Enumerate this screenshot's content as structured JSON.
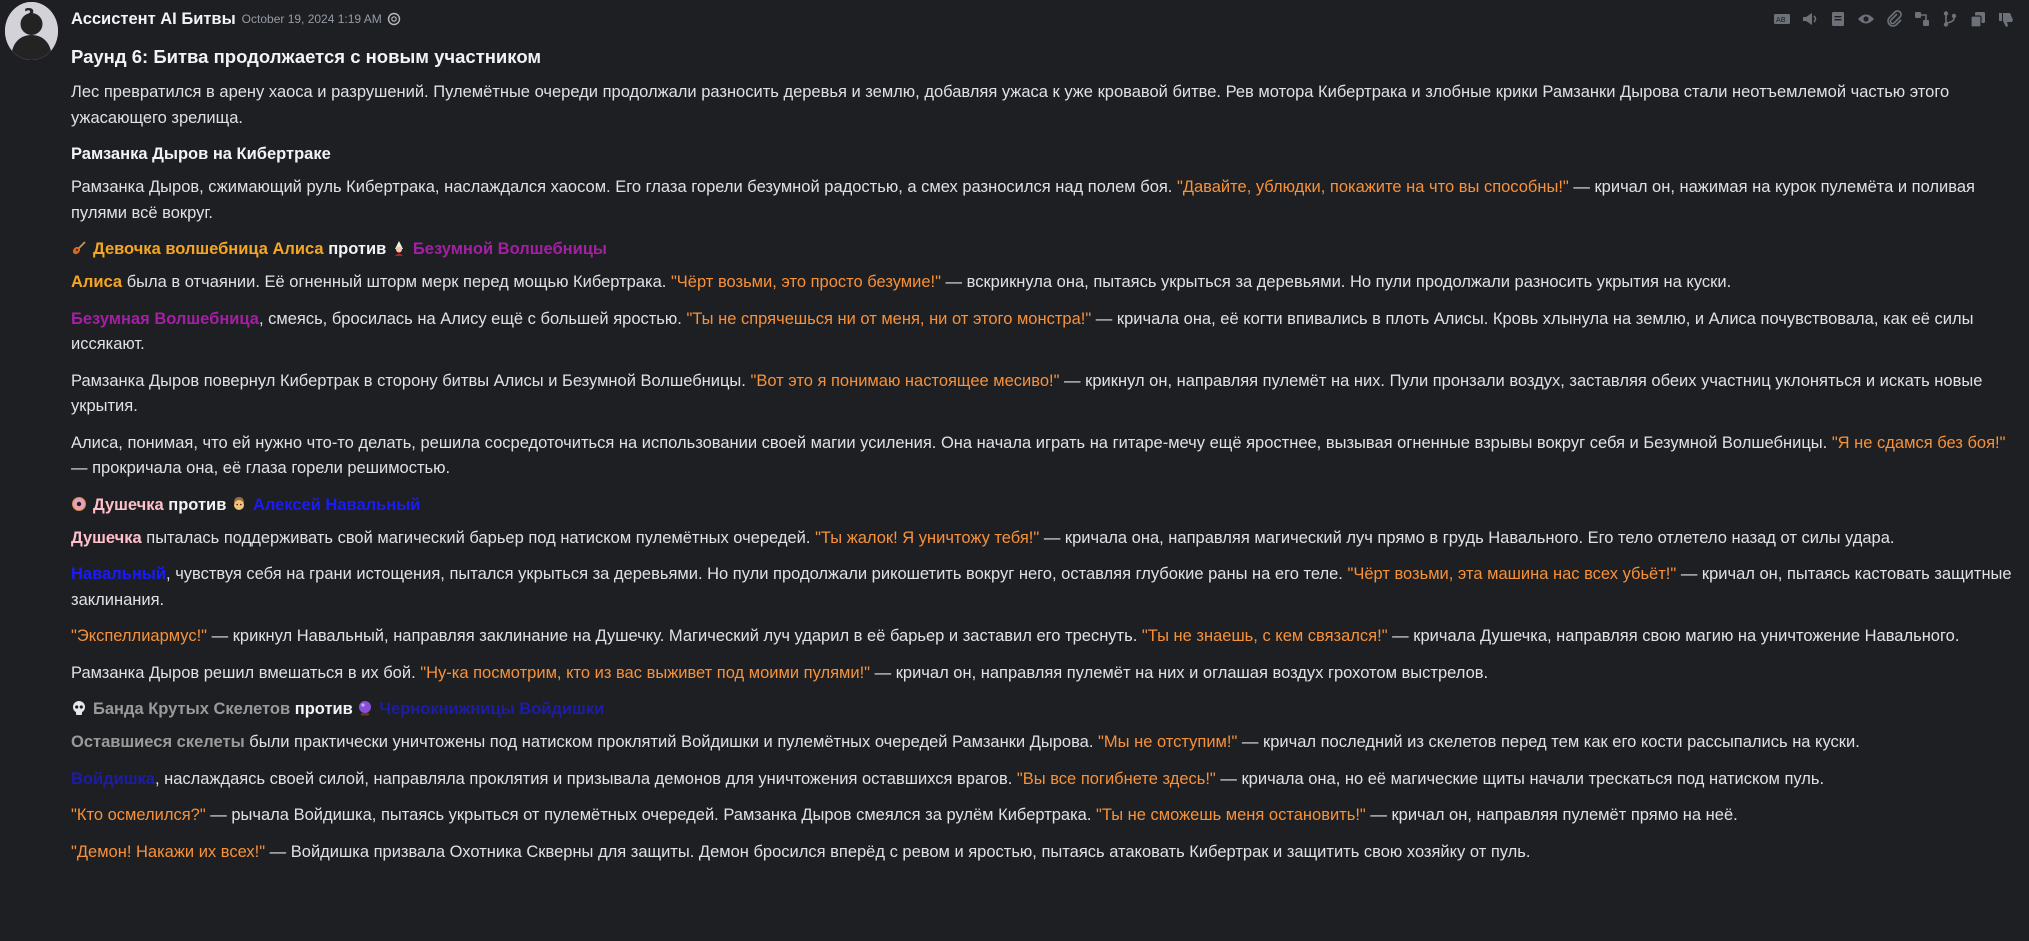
{
  "message": {
    "author": "Ассистент AI Битвы",
    "timestamp": "October 19, 2024 1:19 AM",
    "toolbar_icons": [
      "translate-icon",
      "speaker-icon",
      "document-icon",
      "eye-icon",
      "attachment-icon",
      "fork-icon",
      "branch-icon",
      "copy-icon",
      "thumbs-down-icon"
    ],
    "round_title": "Раунд 6: Битва продолжается с новым участником",
    "intro": "Лес превратился в арену хаоса и разрушений. Пулемётные очереди продолжали разносить деревья и землю, добавляя ужаса к уже кровавой битве. Рев мотора Кибертрака и злобные крики Рамзанки Дырова стали неотъемлемой частью этого ужасающего зрелища.",
    "s1": {
      "heading": "Рамзанка Дыров на Кибертраке",
      "p1": {
        "a": "Рамзанка Дыров, сжимающий руль Кибертрака, наслаждался хаосом. Его глаза горели безумной радостью, а смех разносился над полем боя. ",
        "q": "\"Давайте, ублюдки, покажите на что вы способны!\"",
        "b": " — кричал он, нажимая на курок пулемёта и поливая пулями всё вокруг."
      }
    },
    "s2": {
      "left": "Девочка волшебница Алиса",
      "vs": "против",
      "right": "Безумной Волшебницы",
      "p1": {
        "n": "Алиса",
        "a": " была в отчаянии. Её огненный шторм мерк перед мощью Кибертрака. ",
        "q": "\"Чёрт возьми, это просто безумие!\"",
        "b": " — вскрикнула она, пытаясь укрыться за деревьями. Но пули продолжали разносить укрытия на куски."
      },
      "p2": {
        "n": "Безумная Волшебница",
        "a": ", смеясь, бросилась на Алису ещё с большей яростью. ",
        "q": "\"Ты не спрячешься ни от меня, ни от этого монстра!\"",
        "b": " — кричала она, её когти впивались в плоть Алисы. Кровь хлынула на землю, и Алиса почувствовала, как её силы иссякают."
      },
      "p3": {
        "a": "Рамзанка Дыров повернул Кибертрак в сторону битвы Алисы и Безумной Волшебницы. ",
        "q": "\"Вот это я понимаю настоящее месиво!\"",
        "b": " — крикнул он, направляя пулемёт на них. Пули пронзали воздух, заставляя обеих участниц уклоняться и искать новые укрытия."
      },
      "p4": {
        "a": "Алиса, понимая, что ей нужно что-то делать, решила сосредоточиться на использовании своей магии усиления. Она начала играть на гитаре-мечу ещё яростнее, вызывая огненные взрывы вокруг себя и Безумной Волшебницы. ",
        "q": "\"Я не сдамся без боя!\"",
        "b": " — прокричала она, её глаза горели решимостью."
      }
    },
    "s3": {
      "left": "Душечка",
      "vs": "против",
      "right": "Алексей Навальный",
      "p1": {
        "n": "Душечка",
        "a": " пыталась поддерживать свой магический барьер под натиском пулемётных очередей. ",
        "q": "\"Ты жалок! Я уничтожу тебя!\"",
        "b": " — кричала она, направляя магический луч прямо в грудь Навального. Его тело отлетело назад от силы удара."
      },
      "p2": {
        "n": "Навальный",
        "a": ", чувствуя себя на грани истощения, пытался укрыться за деревьями. Но пули продолжали рикошетить вокруг него, оставляя глубокие раны на его теле. ",
        "q": "\"Чёрт возьми, эта машина нас всех убьёт!\"",
        "b": " — кричал он, пытаясь кастовать защитные заклинания."
      },
      "p3": {
        "q": "\"Экспеллиармус!\"",
        "a": " — крикнул Навальный, направляя заклинание на Душечку. Магический луч ударил в её барьер и заставил его треснуть. ",
        "q2": "\"Ты не знаешь, с кем связался!\"",
        "b": " — кричала Душечка, направляя свою магию на уничтожение Навального."
      },
      "p4": {
        "a": "Рамзанка Дыров решил вмешаться в их бой. ",
        "q": "\"Ну-ка посмотрим, кто из вас выживет под моими пулями!\"",
        "b": " — кричал он, направляя пулемёт на них и оглашая воздух грохотом выстрелов."
      }
    },
    "s4": {
      "left": "Банда Крутых Скелетов",
      "vs": "против",
      "right": "Чернокнижницы Войдишки",
      "p1": {
        "n": "Оставшиеся скелеты",
        "a": " были практически уничтожены под натиском проклятий Войдишки и пулемётных очередей Рамзанки Дырова. ",
        "q": "\"Мы не отступим!\"",
        "b": " — кричал последний из скелетов перед тем как его кости рассыпались на куски."
      },
      "p2": {
        "n": "Войдишка",
        "a": ", наслаждаясь своей силой, направляла проклятия и призывала демонов для уничтожения оставшихся врагов. ",
        "q": "\"Вы все погибнете здесь!\"",
        "b": " — кричала она, но её магические щиты начали трескаться под натиском пуль."
      },
      "p3": {
        "q": "\"Кто осмелился?\"",
        "a": " — рычала Войдишка, пытаясь укрыться от пулемётных очередей. Рамзанка Дыров смеялся за рулём Кибертрака. ",
        "q2": "\"Ты не сможешь меня остановить!\"",
        "b": " — кричал он, направляя пулемёт прямо на неё."
      },
      "p4": {
        "q": "\"Демон! Накажи их всех!\"",
        "a": " — Войдишка призвала Охотника Скверны для защиты. Демон бросился вперёд с ревом и яростью, пытаясь атаковать Кибертрак и защитить свою хозяйку от пуль."
      }
    }
  }
}
